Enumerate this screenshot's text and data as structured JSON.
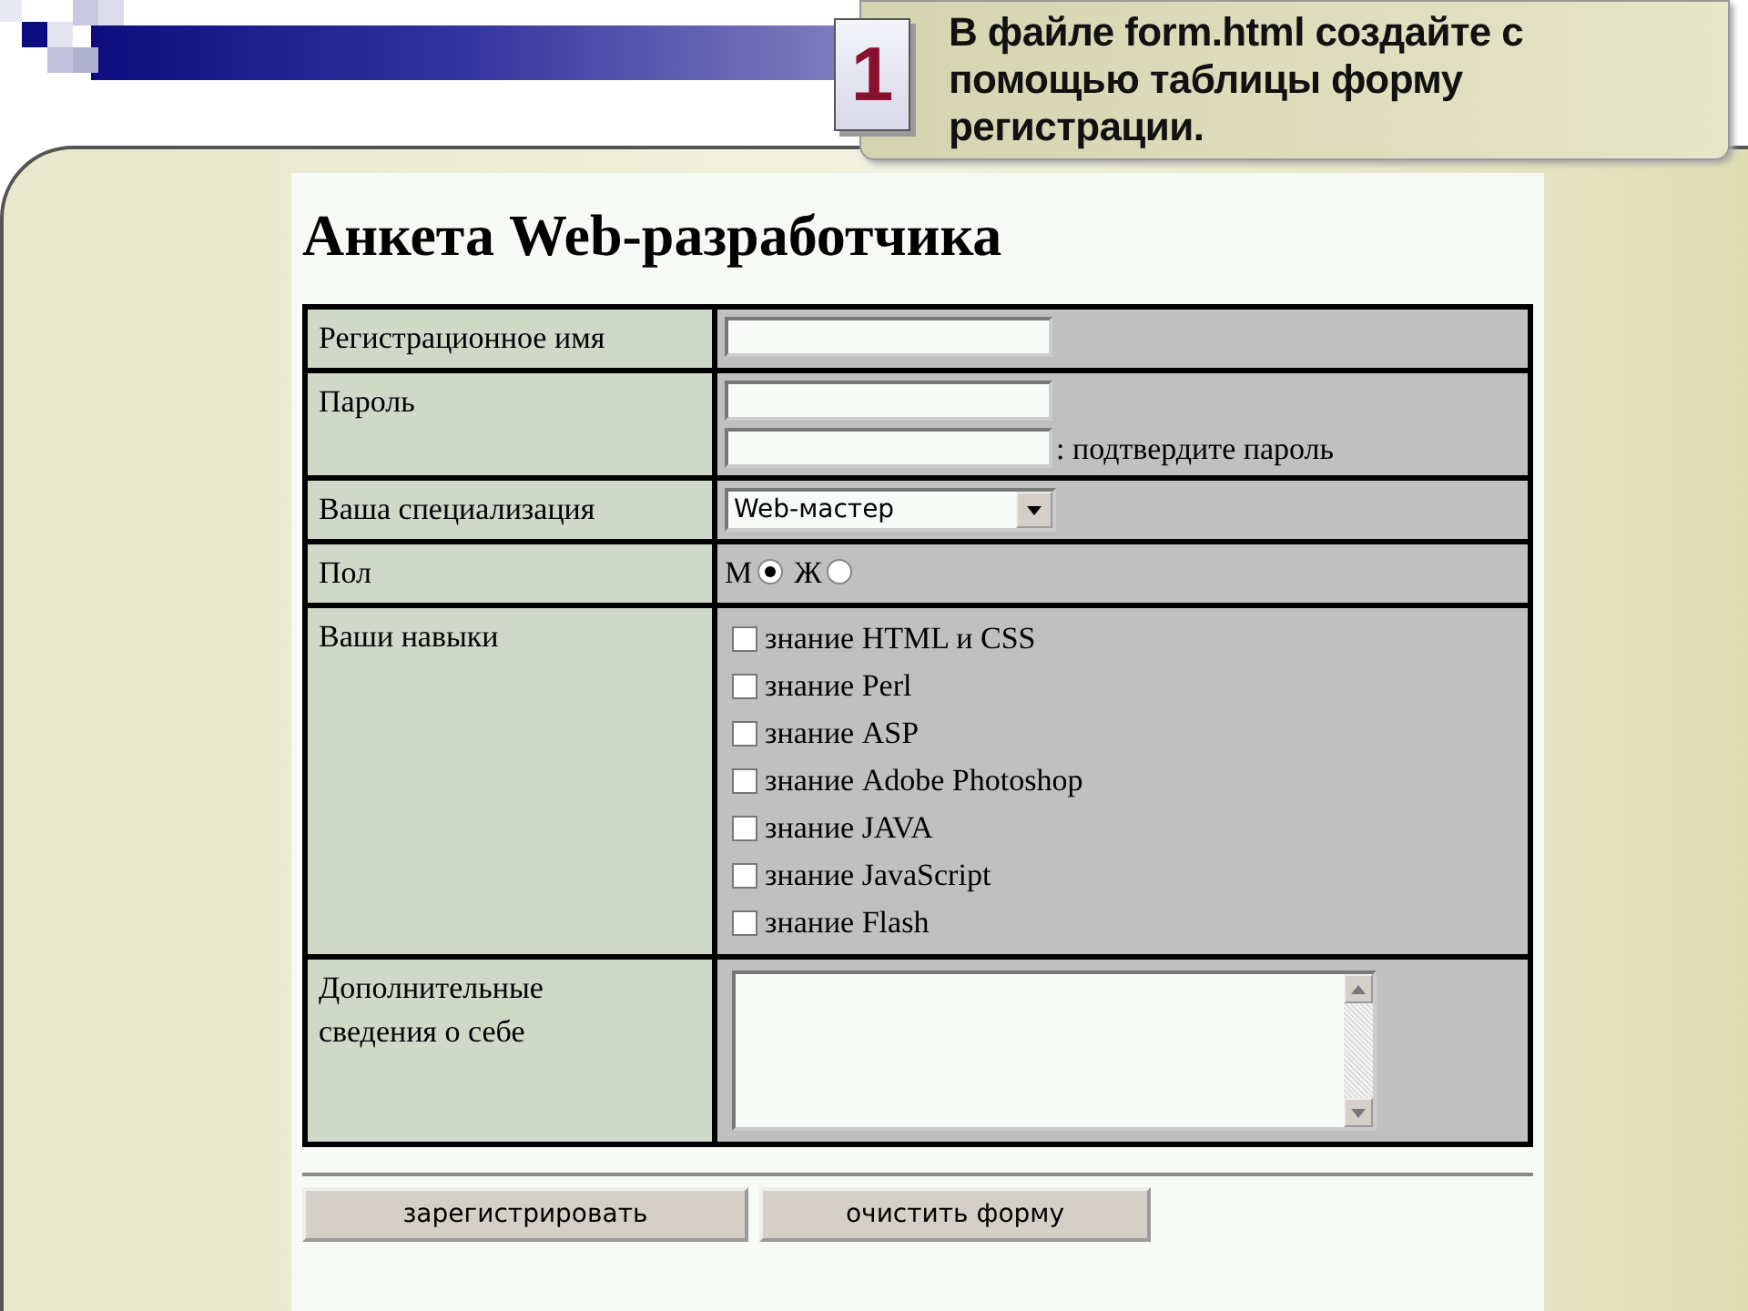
{
  "slide": {
    "number": "1",
    "instruction": "В файле form.html создайте с помощью таблицы форму регистрации."
  },
  "form": {
    "title": "Анкета Web-разработчика",
    "rows": [
      {
        "kind": "text",
        "label": "Регистрационное имя"
      },
      {
        "kind": "password",
        "label": "Пароль",
        "confirm_label": ": подтвердите пароль"
      },
      {
        "kind": "select",
        "label": "Ваша специализация",
        "value": "Web-мастер"
      },
      {
        "kind": "radio",
        "label": "Пол",
        "options": [
          {
            "label": "М",
            "selected": true
          },
          {
            "label": "Ж",
            "selected": false
          }
        ]
      },
      {
        "kind": "checkboxes",
        "label": "Ваши навыки",
        "options": [
          {
            "label": "знание HTML и CSS",
            "checked": false
          },
          {
            "label": "знание Perl",
            "checked": false
          },
          {
            "label": "знание ASP",
            "checked": false
          },
          {
            "label": "знание Adobe Photoshop",
            "checked": false
          },
          {
            "label": "знание JAVA",
            "checked": false
          },
          {
            "label": "знание JavaScript",
            "checked": false
          },
          {
            "label": "знание Flash",
            "checked": false
          }
        ]
      },
      {
        "kind": "textarea",
        "label": "Дополнительные сведения о себе"
      }
    ],
    "buttons": [
      "зарегистрировать",
      "очистить форму"
    ]
  }
}
